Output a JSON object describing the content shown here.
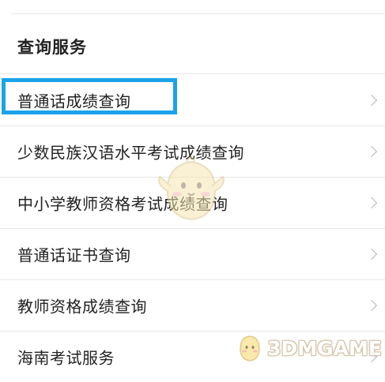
{
  "section": {
    "title": "查询服务"
  },
  "items": [
    {
      "label": "普通话成绩查询",
      "highlighted": true
    },
    {
      "label": "少数民族汉语水平考试成绩查询"
    },
    {
      "label": "中小学教师资格考试成绩查询"
    },
    {
      "label": "普通话证书查询"
    },
    {
      "label": "教师资格成绩查询"
    },
    {
      "label": "海南考试服务"
    }
  ],
  "watermark": {
    "text": "3DMGAME",
    "icon": "mascot-icon"
  },
  "colors": {
    "highlight": "#1aa3e8",
    "divider": "#e6e6e6",
    "chevron": "#b5b5b5",
    "text": "#222222"
  }
}
